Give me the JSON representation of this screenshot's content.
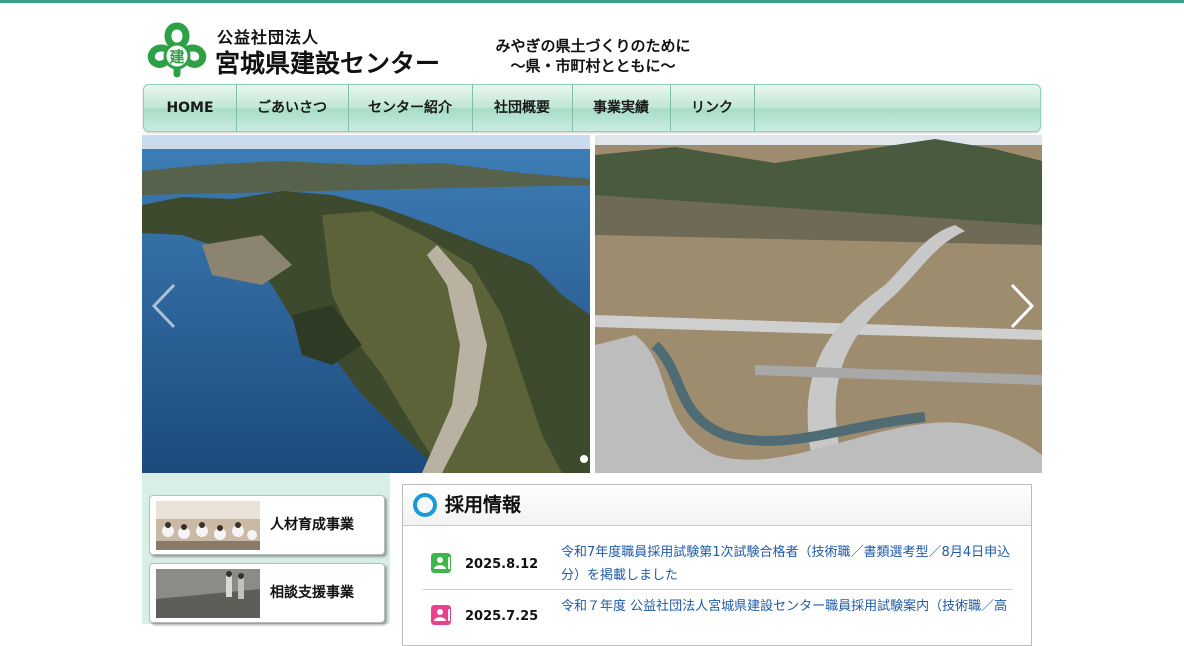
{
  "header": {
    "org_sub": "公益社団法人",
    "org_name": "宮城県建設センター",
    "slogan_line1": "みやぎの県土づくりのために",
    "slogan_line2": "〜県・市町村とともに〜",
    "logo_char": "建"
  },
  "nav": {
    "items": [
      {
        "label": "HOME"
      },
      {
        "label": "ごあいさつ"
      },
      {
        "label": "センター紹介"
      },
      {
        "label": "社団概要"
      },
      {
        "label": "事業実績"
      },
      {
        "label": "リンク"
      }
    ]
  },
  "side": {
    "cards": [
      {
        "label": "人材育成事業"
      },
      {
        "label": "相談支援事業"
      }
    ]
  },
  "news": {
    "title": "採用情報",
    "items": [
      {
        "date": "2025.8.12",
        "text": "令和7年度職員採用試験第1次試験合格者（技術職／書類選考型／8月4日申込分）を掲載しました",
        "icon_color": "#3cb54a"
      },
      {
        "date": "2025.7.25",
        "text": "令和７年度 公益社団法人宮城県建設センター職員採用試験案内（技術職／高",
        "icon_color": "#e8428c"
      }
    ]
  },
  "colors": {
    "accent": "#3a9d8a",
    "link": "#1f5aa8",
    "nav_bg": "#a6dcc5"
  }
}
